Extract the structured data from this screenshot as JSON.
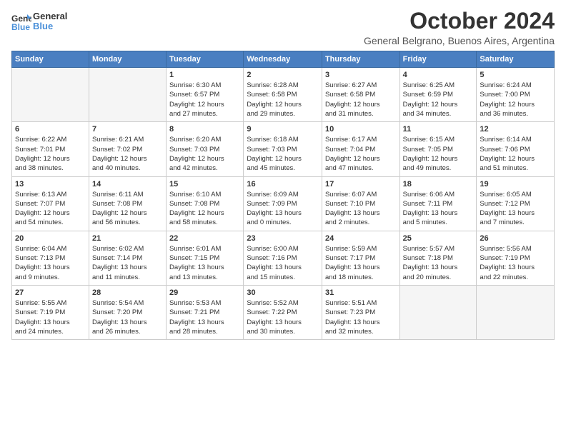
{
  "logo": {
    "line1": "General",
    "line2": "Blue"
  },
  "title": "October 2024",
  "subtitle": "General Belgrano, Buenos Aires, Argentina",
  "days_of_week": [
    "Sunday",
    "Monday",
    "Tuesday",
    "Wednesday",
    "Thursday",
    "Friday",
    "Saturday"
  ],
  "weeks": [
    [
      {
        "day": "",
        "info": ""
      },
      {
        "day": "",
        "info": ""
      },
      {
        "day": "1",
        "info": "Sunrise: 6:30 AM\nSunset: 6:57 PM\nDaylight: 12 hours\nand 27 minutes."
      },
      {
        "day": "2",
        "info": "Sunrise: 6:28 AM\nSunset: 6:58 PM\nDaylight: 12 hours\nand 29 minutes."
      },
      {
        "day": "3",
        "info": "Sunrise: 6:27 AM\nSunset: 6:58 PM\nDaylight: 12 hours\nand 31 minutes."
      },
      {
        "day": "4",
        "info": "Sunrise: 6:25 AM\nSunset: 6:59 PM\nDaylight: 12 hours\nand 34 minutes."
      },
      {
        "day": "5",
        "info": "Sunrise: 6:24 AM\nSunset: 7:00 PM\nDaylight: 12 hours\nand 36 minutes."
      }
    ],
    [
      {
        "day": "6",
        "info": "Sunrise: 6:22 AM\nSunset: 7:01 PM\nDaylight: 12 hours\nand 38 minutes."
      },
      {
        "day": "7",
        "info": "Sunrise: 6:21 AM\nSunset: 7:02 PM\nDaylight: 12 hours\nand 40 minutes."
      },
      {
        "day": "8",
        "info": "Sunrise: 6:20 AM\nSunset: 7:03 PM\nDaylight: 12 hours\nand 42 minutes."
      },
      {
        "day": "9",
        "info": "Sunrise: 6:18 AM\nSunset: 7:03 PM\nDaylight: 12 hours\nand 45 minutes."
      },
      {
        "day": "10",
        "info": "Sunrise: 6:17 AM\nSunset: 7:04 PM\nDaylight: 12 hours\nand 47 minutes."
      },
      {
        "day": "11",
        "info": "Sunrise: 6:15 AM\nSunset: 7:05 PM\nDaylight: 12 hours\nand 49 minutes."
      },
      {
        "day": "12",
        "info": "Sunrise: 6:14 AM\nSunset: 7:06 PM\nDaylight: 12 hours\nand 51 minutes."
      }
    ],
    [
      {
        "day": "13",
        "info": "Sunrise: 6:13 AM\nSunset: 7:07 PM\nDaylight: 12 hours\nand 54 minutes."
      },
      {
        "day": "14",
        "info": "Sunrise: 6:11 AM\nSunset: 7:08 PM\nDaylight: 12 hours\nand 56 minutes."
      },
      {
        "day": "15",
        "info": "Sunrise: 6:10 AM\nSunset: 7:08 PM\nDaylight: 12 hours\nand 58 minutes."
      },
      {
        "day": "16",
        "info": "Sunrise: 6:09 AM\nSunset: 7:09 PM\nDaylight: 13 hours\nand 0 minutes."
      },
      {
        "day": "17",
        "info": "Sunrise: 6:07 AM\nSunset: 7:10 PM\nDaylight: 13 hours\nand 2 minutes."
      },
      {
        "day": "18",
        "info": "Sunrise: 6:06 AM\nSunset: 7:11 PM\nDaylight: 13 hours\nand 5 minutes."
      },
      {
        "day": "19",
        "info": "Sunrise: 6:05 AM\nSunset: 7:12 PM\nDaylight: 13 hours\nand 7 minutes."
      }
    ],
    [
      {
        "day": "20",
        "info": "Sunrise: 6:04 AM\nSunset: 7:13 PM\nDaylight: 13 hours\nand 9 minutes."
      },
      {
        "day": "21",
        "info": "Sunrise: 6:02 AM\nSunset: 7:14 PM\nDaylight: 13 hours\nand 11 minutes."
      },
      {
        "day": "22",
        "info": "Sunrise: 6:01 AM\nSunset: 7:15 PM\nDaylight: 13 hours\nand 13 minutes."
      },
      {
        "day": "23",
        "info": "Sunrise: 6:00 AM\nSunset: 7:16 PM\nDaylight: 13 hours\nand 15 minutes."
      },
      {
        "day": "24",
        "info": "Sunrise: 5:59 AM\nSunset: 7:17 PM\nDaylight: 13 hours\nand 18 minutes."
      },
      {
        "day": "25",
        "info": "Sunrise: 5:57 AM\nSunset: 7:18 PM\nDaylight: 13 hours\nand 20 minutes."
      },
      {
        "day": "26",
        "info": "Sunrise: 5:56 AM\nSunset: 7:19 PM\nDaylight: 13 hours\nand 22 minutes."
      }
    ],
    [
      {
        "day": "27",
        "info": "Sunrise: 5:55 AM\nSunset: 7:19 PM\nDaylight: 13 hours\nand 24 minutes."
      },
      {
        "day": "28",
        "info": "Sunrise: 5:54 AM\nSunset: 7:20 PM\nDaylight: 13 hours\nand 26 minutes."
      },
      {
        "day": "29",
        "info": "Sunrise: 5:53 AM\nSunset: 7:21 PM\nDaylight: 13 hours\nand 28 minutes."
      },
      {
        "day": "30",
        "info": "Sunrise: 5:52 AM\nSunset: 7:22 PM\nDaylight: 13 hours\nand 30 minutes."
      },
      {
        "day": "31",
        "info": "Sunrise: 5:51 AM\nSunset: 7:23 PM\nDaylight: 13 hours\nand 32 minutes."
      },
      {
        "day": "",
        "info": ""
      },
      {
        "day": "",
        "info": ""
      }
    ]
  ]
}
